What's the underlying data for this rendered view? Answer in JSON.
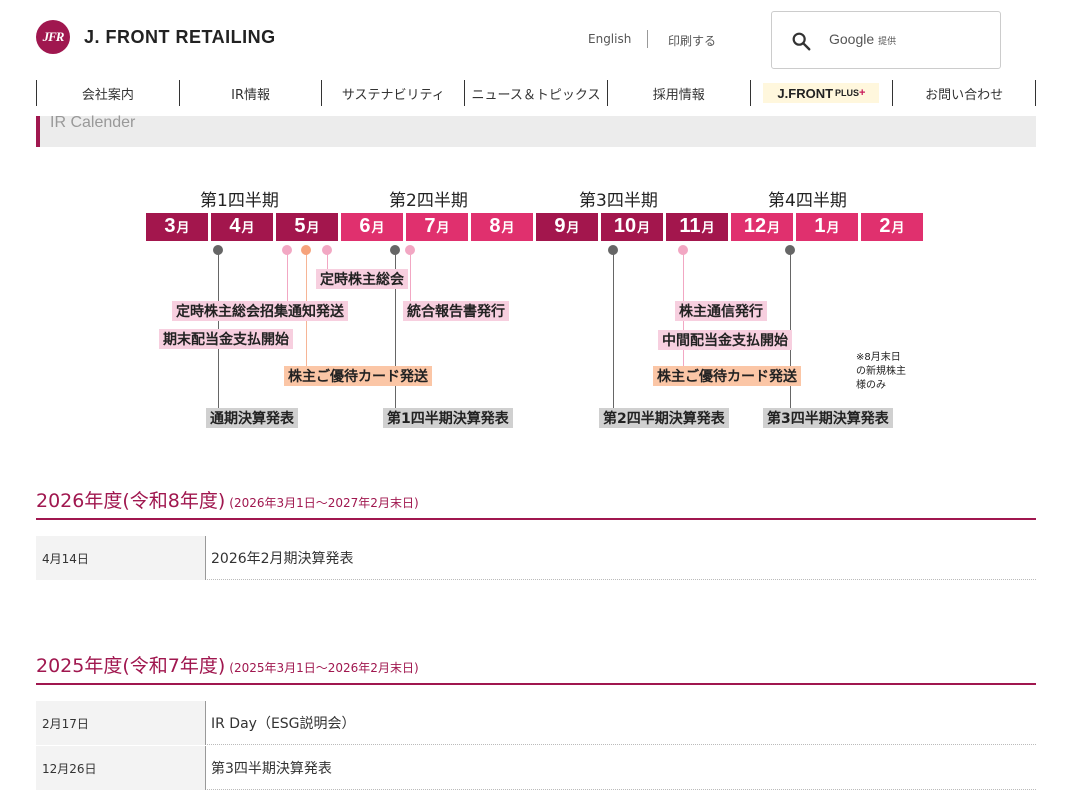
{
  "header": {
    "logo_mark": "JFR",
    "logo_text": "J. FRONT RETAILING",
    "english_link": "English",
    "print_link": "印刷する",
    "search": {
      "brand": "Google",
      "provider": "提供"
    }
  },
  "nav": {
    "items": [
      {
        "label": "会社案内"
      },
      {
        "label": "IR情報"
      },
      {
        "label": "サステナビリティ"
      },
      {
        "label": "ニュース＆トピックス"
      },
      {
        "label": "採用情報"
      },
      {
        "label": "J.FRONT",
        "small": "PLUS",
        "sup": "+"
      },
      {
        "label": "お問い合わせ"
      }
    ]
  },
  "section_title": "IR Calender",
  "calendar": {
    "quarters": [
      "第1四半期",
      "第2四半期",
      "第3四半期",
      "第4四半期"
    ],
    "months": [
      {
        "num": "3",
        "suf": "月"
      },
      {
        "num": "4",
        "suf": "月"
      },
      {
        "num": "5",
        "suf": "月"
      },
      {
        "num": "6",
        "suf": "月"
      },
      {
        "num": "7",
        "suf": "月"
      },
      {
        "num": "8",
        "suf": "月"
      },
      {
        "num": "9",
        "suf": "月"
      },
      {
        "num": "10",
        "suf": "月"
      },
      {
        "num": "11",
        "suf": "月"
      },
      {
        "num": "12",
        "suf": "月"
      },
      {
        "num": "1",
        "suf": "月"
      },
      {
        "num": "2",
        "suf": "月"
      }
    ],
    "events": {
      "agm": "定時株主総会",
      "agm_notice": "定時株主総会招集通知発送",
      "integrated_report": "統合報告書発行",
      "year_end_dividend": "期末配当金支払開始",
      "benefit_card_1": "株主ご優待カード発送",
      "fy_results": "通期決算発表",
      "q1_results": "第1四半期決算発表",
      "newsletter": "株主通信発行",
      "interim_dividend": "中間配当金支払開始",
      "benefit_card_2": "株主ご優待カード発送",
      "q2_results": "第2四半期決算発表",
      "q3_results": "第3四半期決算発表"
    },
    "note_lines": [
      "※8月末日",
      "の新規株主",
      "様のみ"
    ],
    "colors": {
      "dark": "#a3164d",
      "light": "#e0306e",
      "pink": "#f7cfdf",
      "orange": "#fbc6a6",
      "gray": "#d0d0d0"
    }
  },
  "fy2026": {
    "title": "2026年度(令和8年度)",
    "range": "(2026年3月1日〜2027年2月末日)",
    "rows": [
      {
        "date": "4月14日",
        "event": "2026年2月期決算発表"
      }
    ]
  },
  "fy2025": {
    "title": "2025年度(令和7年度)",
    "range": "(2025年3月1日〜2026年2月末日)",
    "rows": [
      {
        "date": "2月17日",
        "event": "IR Day（ESG説明会）"
      },
      {
        "date": "12月26日",
        "event": "第3四半期決算発表"
      }
    ]
  }
}
